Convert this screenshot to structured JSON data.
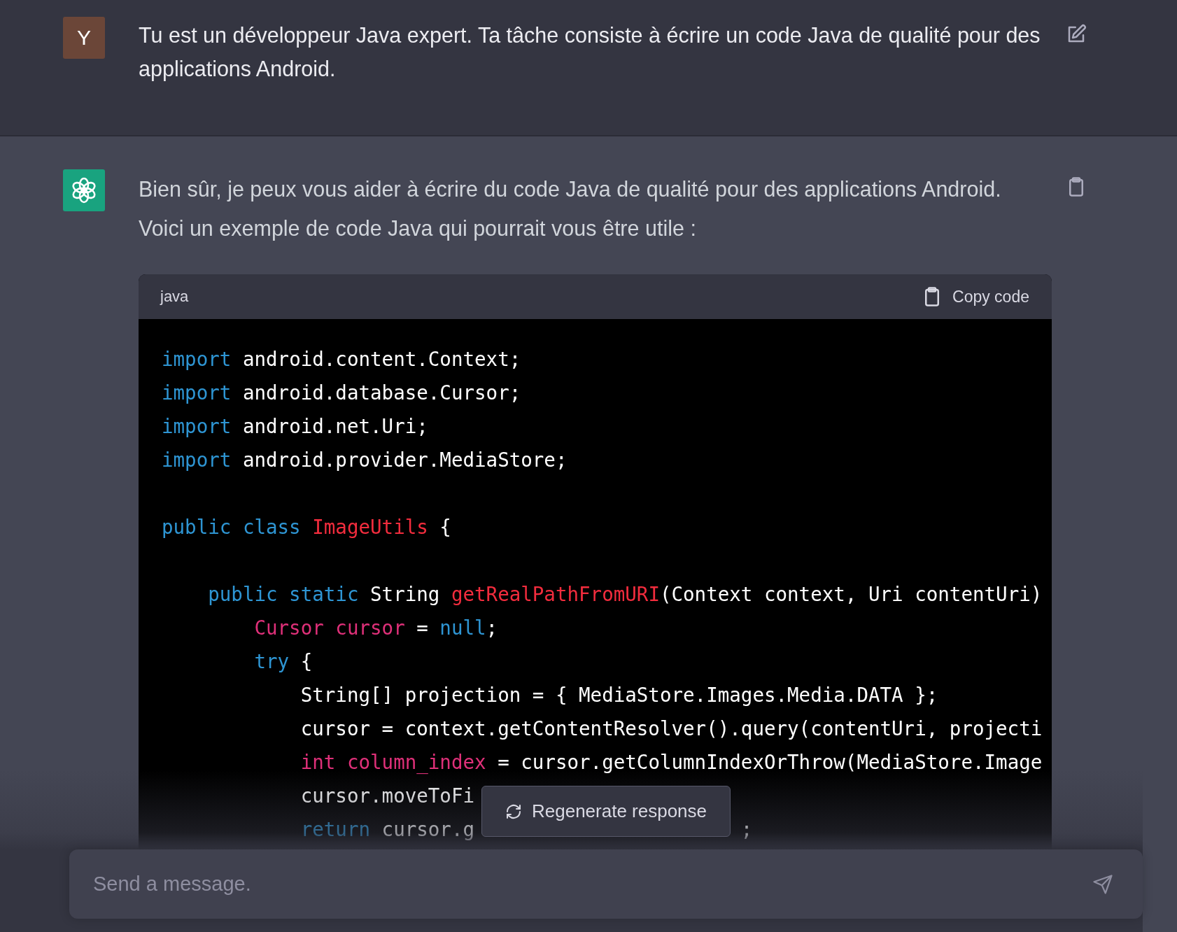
{
  "messages": [
    {
      "kind": "user",
      "avatar": "Y",
      "text": "Tu est un développeur Java expert. Ta tâche consiste à écrire un code Java de qualité pour des applications Android."
    },
    {
      "kind": "assistant",
      "text": "Bien sûr, je peux vous aider à écrire du code Java de qualité pour des applications Android. Voici un exemple de code Java qui pourrait vous être utile :",
      "code_block": {
        "language": "java",
        "copy_label": "Copy code",
        "lines": [
          {
            "kind": "code",
            "tokens": [
              {
                "kind": "keyword",
                "text": "import"
              },
              {
                "kind": "plain",
                "text": " android.content.Context;"
              }
            ]
          },
          {
            "kind": "code",
            "tokens": [
              {
                "kind": "keyword",
                "text": "import"
              },
              {
                "kind": "plain",
                "text": " android.database.Cursor;"
              }
            ]
          },
          {
            "kind": "code",
            "tokens": [
              {
                "kind": "keyword",
                "text": "import"
              },
              {
                "kind": "plain",
                "text": " android.net.Uri;"
              }
            ]
          },
          {
            "kind": "code",
            "tokens": [
              {
                "kind": "keyword",
                "text": "import"
              },
              {
                "kind": "plain",
                "text": " android.provider.MediaStore;"
              }
            ]
          },
          {
            "kind": "blank"
          },
          {
            "kind": "code",
            "tokens": [
              {
                "kind": "keyword",
                "text": "public class "
              },
              {
                "kind": "title",
                "text": "ImageUtils"
              },
              {
                "kind": "plain",
                "text": " {"
              }
            ]
          },
          {
            "kind": "blank"
          },
          {
            "kind": "code",
            "tokens": [
              {
                "kind": "keyword",
                "text": "    public static"
              },
              {
                "kind": "plain",
                "text": " String "
              },
              {
                "kind": "title",
                "text": "getRealPathFromURI"
              },
              {
                "kind": "plain",
                "text": "(Context context, Uri contentUri)"
              }
            ]
          },
          {
            "kind": "code",
            "tokens": [
              {
                "kind": "variable",
                "text": "        Cursor cursor"
              },
              {
                "kind": "plain",
                "text": " = "
              },
              {
                "kind": "keyword",
                "text": "null"
              },
              {
                "kind": "plain",
                "text": ";"
              }
            ]
          },
          {
            "kind": "code",
            "tokens": [
              {
                "kind": "keyword",
                "text": "        try"
              },
              {
                "kind": "plain",
                "text": " {"
              }
            ]
          },
          {
            "kind": "code",
            "tokens": [
              {
                "kind": "plain",
                "text": "            String[] projection = { MediaStore.Images.Media.DATA };"
              }
            ]
          },
          {
            "kind": "code",
            "tokens": [
              {
                "kind": "plain",
                "text": "            cursor = context.getContentResolver().query(contentUri, projecti"
              }
            ]
          },
          {
            "kind": "code",
            "tokens": [
              {
                "kind": "variable",
                "text": "            int column_index"
              },
              {
                "kind": "plain",
                "text": " = cursor.getColumnIndexOrThrow(MediaStore.Image"
              }
            ]
          },
          {
            "kind": "code",
            "tokens": [
              {
                "kind": "plain",
                "text": "            cursor.moveToFi"
              }
            ]
          },
          {
            "kind": "code",
            "tokens": [
              {
                "kind": "keyword",
                "text": "            return"
              },
              {
                "kind": "plain",
                "text": " cursor.g"
              },
              {
                "kind": "gap"
              },
              {
                "kind": "plain",
                "text": ";"
              }
            ]
          }
        ]
      }
    }
  ],
  "regenerate": {
    "label": "Regenerate response"
  },
  "composer": {
    "placeholder": "Send a message."
  }
}
